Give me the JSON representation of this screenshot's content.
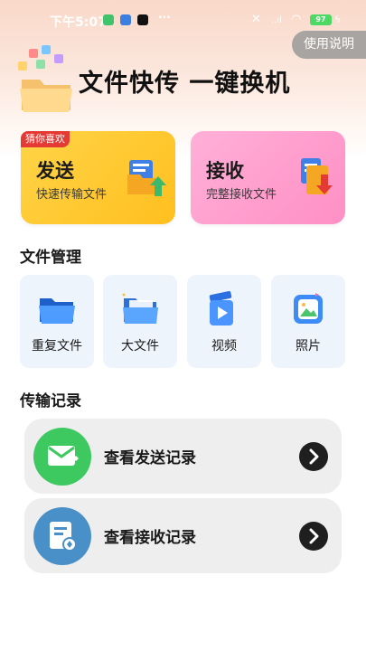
{
  "status_bar": {
    "time": "下午5:07",
    "battery": "97",
    "more": "···"
  },
  "help_button": "使用说明",
  "hero": {
    "title": "文件快传 一键换机"
  },
  "cards": {
    "send": {
      "badge": "猜你喜欢",
      "title": "发送",
      "subtitle": "快速传输文件",
      "color": "#ffc933"
    },
    "receive": {
      "title": "接收",
      "subtitle": "完整接收文件",
      "color": "#ff9fcf"
    }
  },
  "file_management": {
    "title": "文件管理",
    "items": [
      {
        "label": "重复文件",
        "icon": "folder-icon"
      },
      {
        "label": "大文件",
        "icon": "big-file-icon"
      },
      {
        "label": "视频",
        "icon": "video-icon"
      },
      {
        "label": "照片",
        "icon": "photo-icon"
      }
    ]
  },
  "transfer_records": {
    "title": "传输记录",
    "items": [
      {
        "label": "查看发送记录",
        "icon": "mail-icon",
        "color": "#3dc95f"
      },
      {
        "label": "查看接收记录",
        "icon": "document-icon",
        "color": "#4a90c8"
      }
    ]
  }
}
